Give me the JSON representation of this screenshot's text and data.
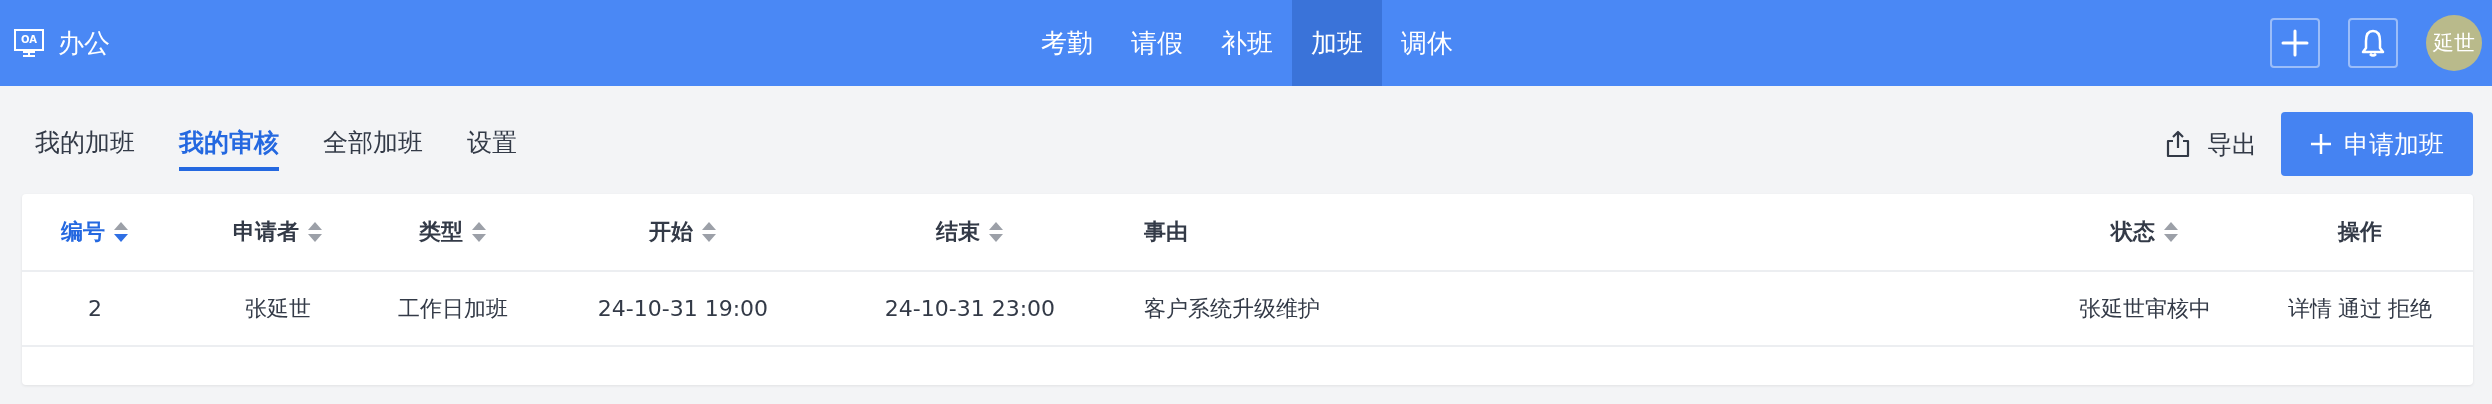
{
  "header": {
    "logo": "OA",
    "title": "办公",
    "avatar": "延世"
  },
  "nav": [
    {
      "label": "考勤",
      "selected": false
    },
    {
      "label": "请假",
      "selected": false
    },
    {
      "label": "补班",
      "selected": false
    },
    {
      "label": "加班",
      "selected": true
    },
    {
      "label": "调休",
      "selected": false
    }
  ],
  "tabs": [
    {
      "label": "我的加班",
      "selected": false
    },
    {
      "label": "我的审核",
      "selected": true
    },
    {
      "label": "全部加班",
      "selected": false
    },
    {
      "label": "设置",
      "selected": false
    }
  ],
  "toolbar": {
    "export": "导出",
    "create": "申请加班"
  },
  "table": {
    "columns": [
      {
        "label": "编号",
        "sorted": true
      },
      {
        "label": "申请者",
        "sorted": false
      },
      {
        "label": "类型",
        "sorted": false
      },
      {
        "label": "开始",
        "sorted": false
      },
      {
        "label": "结束",
        "sorted": false
      },
      {
        "label": "事由"
      },
      {
        "label": "状态",
        "sorted": false
      },
      {
        "label": "操作"
      }
    ],
    "rows": [
      {
        "cells": [
          "2",
          "张延世",
          "工作日加班",
          "24-10-31 19:00",
          "24-10-31 23:00",
          "客户系统升级维护",
          "张延世审核中"
        ],
        "actions": [
          "详情",
          "通过",
          "拒绝"
        ]
      }
    ]
  }
}
